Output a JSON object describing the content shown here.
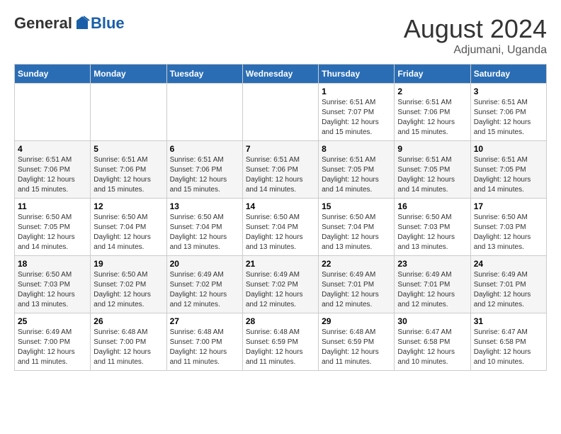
{
  "header": {
    "logo": {
      "general": "General",
      "blue": "Blue"
    },
    "title": "August 2024",
    "location": "Adjumani, Uganda"
  },
  "weekdays": [
    "Sunday",
    "Monday",
    "Tuesday",
    "Wednesday",
    "Thursday",
    "Friday",
    "Saturday"
  ],
  "weeks": [
    [
      {
        "day": "",
        "info": ""
      },
      {
        "day": "",
        "info": ""
      },
      {
        "day": "",
        "info": ""
      },
      {
        "day": "",
        "info": ""
      },
      {
        "day": "1",
        "info": "Sunrise: 6:51 AM\nSunset: 7:07 PM\nDaylight: 12 hours\nand 15 minutes."
      },
      {
        "day": "2",
        "info": "Sunrise: 6:51 AM\nSunset: 7:06 PM\nDaylight: 12 hours\nand 15 minutes."
      },
      {
        "day": "3",
        "info": "Sunrise: 6:51 AM\nSunset: 7:06 PM\nDaylight: 12 hours\nand 15 minutes."
      }
    ],
    [
      {
        "day": "4",
        "info": "Sunrise: 6:51 AM\nSunset: 7:06 PM\nDaylight: 12 hours\nand 15 minutes."
      },
      {
        "day": "5",
        "info": "Sunrise: 6:51 AM\nSunset: 7:06 PM\nDaylight: 12 hours\nand 15 minutes."
      },
      {
        "day": "6",
        "info": "Sunrise: 6:51 AM\nSunset: 7:06 PM\nDaylight: 12 hours\nand 15 minutes."
      },
      {
        "day": "7",
        "info": "Sunrise: 6:51 AM\nSunset: 7:06 PM\nDaylight: 12 hours\nand 14 minutes."
      },
      {
        "day": "8",
        "info": "Sunrise: 6:51 AM\nSunset: 7:05 PM\nDaylight: 12 hours\nand 14 minutes."
      },
      {
        "day": "9",
        "info": "Sunrise: 6:51 AM\nSunset: 7:05 PM\nDaylight: 12 hours\nand 14 minutes."
      },
      {
        "day": "10",
        "info": "Sunrise: 6:51 AM\nSunset: 7:05 PM\nDaylight: 12 hours\nand 14 minutes."
      }
    ],
    [
      {
        "day": "11",
        "info": "Sunrise: 6:50 AM\nSunset: 7:05 PM\nDaylight: 12 hours\nand 14 minutes."
      },
      {
        "day": "12",
        "info": "Sunrise: 6:50 AM\nSunset: 7:04 PM\nDaylight: 12 hours\nand 14 minutes."
      },
      {
        "day": "13",
        "info": "Sunrise: 6:50 AM\nSunset: 7:04 PM\nDaylight: 12 hours\nand 13 minutes."
      },
      {
        "day": "14",
        "info": "Sunrise: 6:50 AM\nSunset: 7:04 PM\nDaylight: 12 hours\nand 13 minutes."
      },
      {
        "day": "15",
        "info": "Sunrise: 6:50 AM\nSunset: 7:04 PM\nDaylight: 12 hours\nand 13 minutes."
      },
      {
        "day": "16",
        "info": "Sunrise: 6:50 AM\nSunset: 7:03 PM\nDaylight: 12 hours\nand 13 minutes."
      },
      {
        "day": "17",
        "info": "Sunrise: 6:50 AM\nSunset: 7:03 PM\nDaylight: 12 hours\nand 13 minutes."
      }
    ],
    [
      {
        "day": "18",
        "info": "Sunrise: 6:50 AM\nSunset: 7:03 PM\nDaylight: 12 hours\nand 13 minutes."
      },
      {
        "day": "19",
        "info": "Sunrise: 6:50 AM\nSunset: 7:02 PM\nDaylight: 12 hours\nand 12 minutes."
      },
      {
        "day": "20",
        "info": "Sunrise: 6:49 AM\nSunset: 7:02 PM\nDaylight: 12 hours\nand 12 minutes."
      },
      {
        "day": "21",
        "info": "Sunrise: 6:49 AM\nSunset: 7:02 PM\nDaylight: 12 hours\nand 12 minutes."
      },
      {
        "day": "22",
        "info": "Sunrise: 6:49 AM\nSunset: 7:01 PM\nDaylight: 12 hours\nand 12 minutes."
      },
      {
        "day": "23",
        "info": "Sunrise: 6:49 AM\nSunset: 7:01 PM\nDaylight: 12 hours\nand 12 minutes."
      },
      {
        "day": "24",
        "info": "Sunrise: 6:49 AM\nSunset: 7:01 PM\nDaylight: 12 hours\nand 12 minutes."
      }
    ],
    [
      {
        "day": "25",
        "info": "Sunrise: 6:49 AM\nSunset: 7:00 PM\nDaylight: 12 hours\nand 11 minutes."
      },
      {
        "day": "26",
        "info": "Sunrise: 6:48 AM\nSunset: 7:00 PM\nDaylight: 12 hours\nand 11 minutes."
      },
      {
        "day": "27",
        "info": "Sunrise: 6:48 AM\nSunset: 7:00 PM\nDaylight: 12 hours\nand 11 minutes."
      },
      {
        "day": "28",
        "info": "Sunrise: 6:48 AM\nSunset: 6:59 PM\nDaylight: 12 hours\nand 11 minutes."
      },
      {
        "day": "29",
        "info": "Sunrise: 6:48 AM\nSunset: 6:59 PM\nDaylight: 12 hours\nand 11 minutes."
      },
      {
        "day": "30",
        "info": "Sunrise: 6:47 AM\nSunset: 6:58 PM\nDaylight: 12 hours\nand 10 minutes."
      },
      {
        "day": "31",
        "info": "Sunrise: 6:47 AM\nSunset: 6:58 PM\nDaylight: 12 hours\nand 10 minutes."
      }
    ]
  ]
}
